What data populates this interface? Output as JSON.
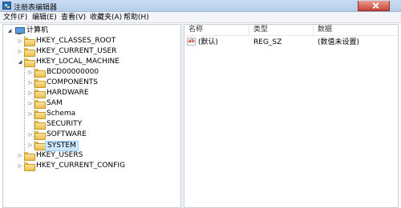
{
  "window": {
    "title": "注册表编辑器"
  },
  "menu": [
    {
      "label": "文件(F)"
    },
    {
      "label": "编辑(E)"
    },
    {
      "label": "查看(V)"
    },
    {
      "label": "收藏夹(A)"
    },
    {
      "label": "帮助(H)"
    }
  ],
  "tree": {
    "root": "计算机",
    "hives": [
      {
        "label": "HKEY_CLASSES_ROOT",
        "expanded": false
      },
      {
        "label": "HKEY_CURRENT_USER",
        "expanded": false
      },
      {
        "label": "HKEY_LOCAL_MACHINE",
        "expanded": true
      },
      {
        "label": "HKEY_USERS",
        "expanded": false
      },
      {
        "label": "HKEY_CURRENT_CONFIG",
        "expanded": false
      }
    ],
    "hklm_children": [
      {
        "label": "BCD00000000",
        "has_children": true
      },
      {
        "label": "COMPONENTS",
        "has_children": true
      },
      {
        "label": "HARDWARE",
        "has_children": true
      },
      {
        "label": "SAM",
        "has_children": true
      },
      {
        "label": "Schema",
        "has_children": true
      },
      {
        "label": "SECURITY",
        "has_children": false
      },
      {
        "label": "SOFTWARE",
        "has_children": true
      },
      {
        "label": "SYSTEM",
        "has_children": true,
        "selected": true
      }
    ]
  },
  "list": {
    "columns": [
      "名称",
      "类型",
      "数据"
    ],
    "rows": [
      {
        "icon": "ab",
        "name": "(默认)",
        "type": "REG_SZ",
        "data": "(数值未设置)"
      }
    ]
  }
}
